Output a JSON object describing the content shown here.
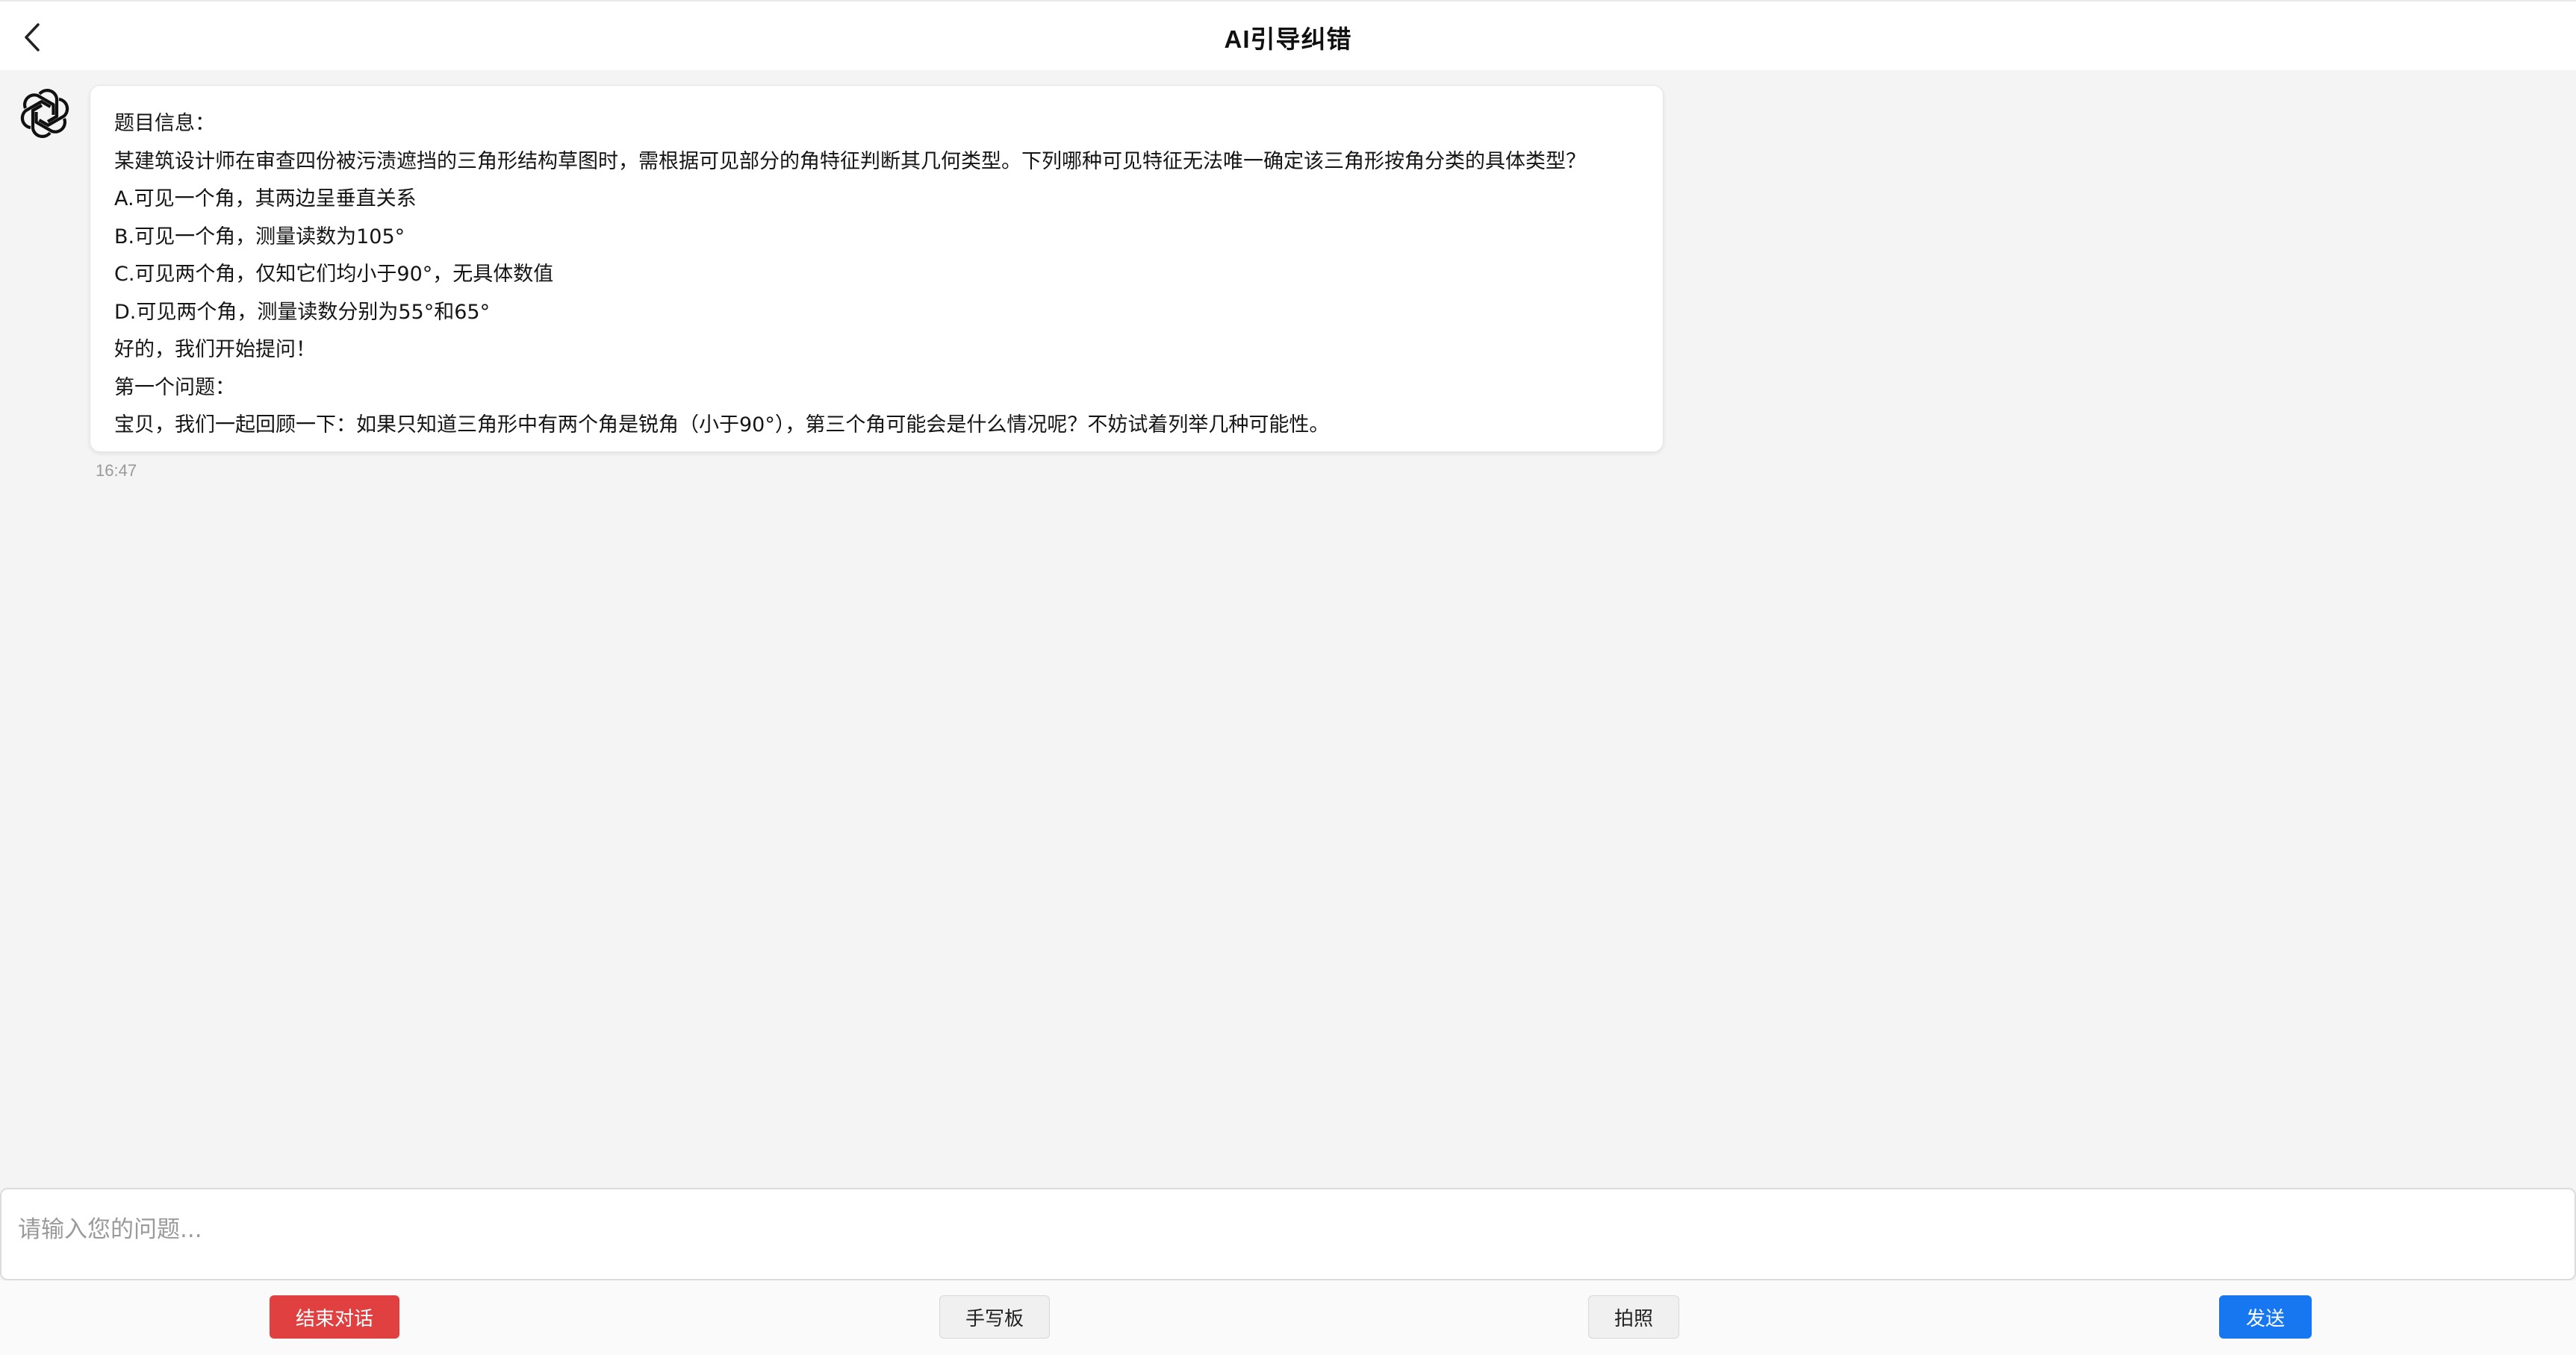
{
  "header": {
    "title": "AI引导纠错"
  },
  "chat": {
    "messages": [
      {
        "sender": "assistant",
        "lines": [
          "题目信息：",
          "某建筑设计师在审查四份被污渍遮挡的三角形结构草图时，需根据可见部分的角特征判断其几何类型。下列哪种可见特征无法唯一确定该三角形按角分类的具体类型？",
          "A.可见一个角，其两边呈垂直关系",
          "B.可见一个角，测量读数为105°",
          "C.可见两个角，仅知它们均小于90°，无具体数值",
          "D.可见两个角，测量读数分别为55°和65°",
          "好的，我们开始提问！",
          "第一个问题：",
          "宝贝，我们一起回顾一下：如果只知道三角形中有两个角是锐角（小于90°），第三个角可能会是什么情况呢？不妨试着列举几种可能性。"
        ],
        "time": "16:47"
      }
    ]
  },
  "input": {
    "placeholder": "请输入您的问题...",
    "value": ""
  },
  "actions": {
    "end_label": "结束对话",
    "handwriting_label": "手写板",
    "photo_label": "拍照",
    "send_label": "发送"
  },
  "icons": {
    "back": "chevron-left-icon",
    "avatar": "openai-logo-icon"
  },
  "colors": {
    "end_button": "#e04040",
    "send_button": "#1677f0",
    "background": "#f4f4f4"
  }
}
